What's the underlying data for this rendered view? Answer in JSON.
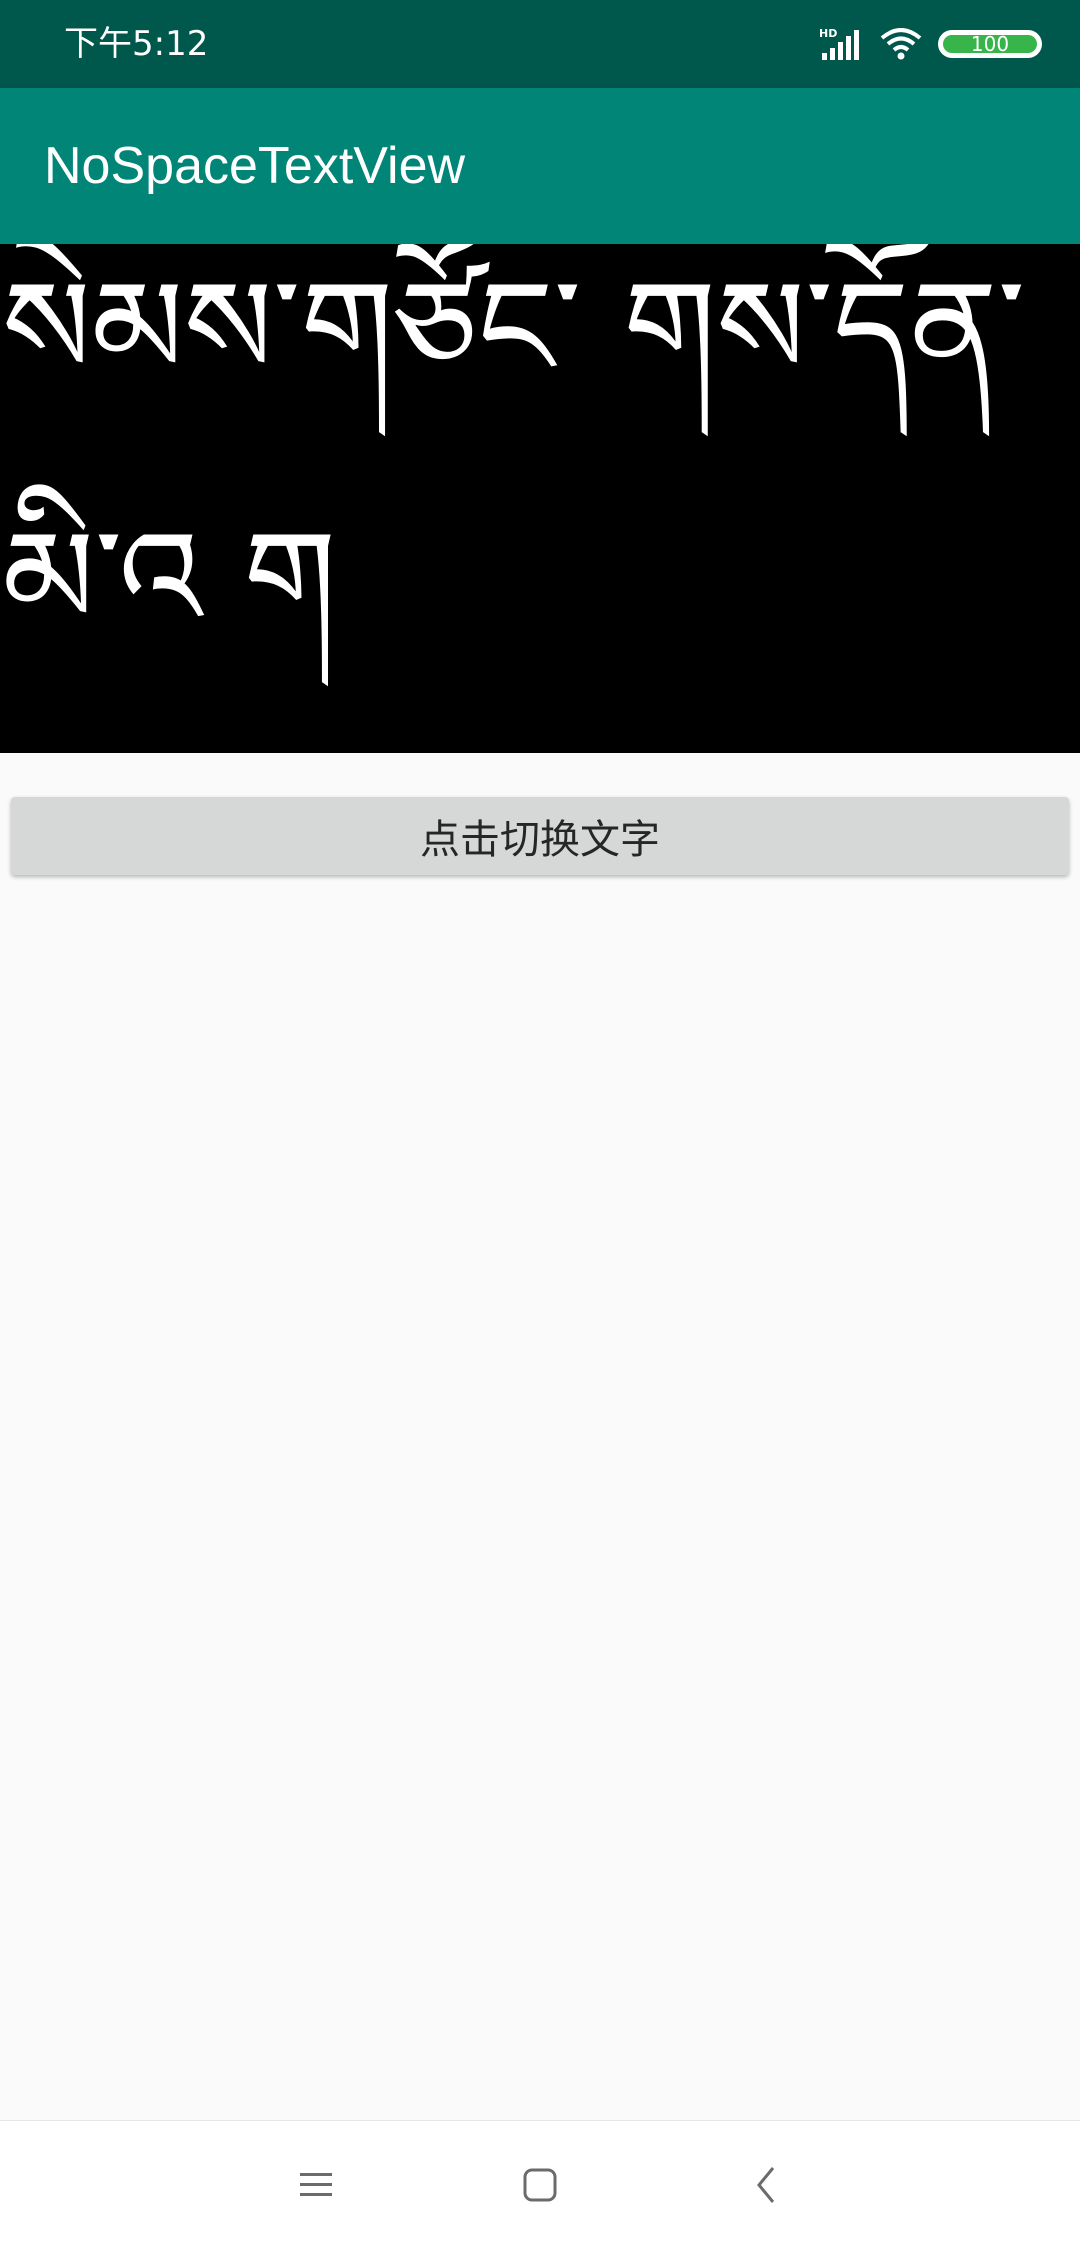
{
  "status_bar": {
    "time": "下午5:12",
    "network_label": "HD",
    "battery_level": "100",
    "background_color": "#00574b",
    "icons": [
      "hd-signal-icon",
      "wifi-icon",
      "battery-icon"
    ]
  },
  "app_bar": {
    "title": "NoSpaceTextView",
    "background_color": "#008577"
  },
  "content": {
    "tibetan_text": "སེམས་གཙོང་ གས་དོན་མི་འ ག",
    "button_label": "点击切换文字"
  },
  "nav_bar": {
    "icons": [
      "menu-icon",
      "home-icon",
      "back-icon"
    ]
  }
}
